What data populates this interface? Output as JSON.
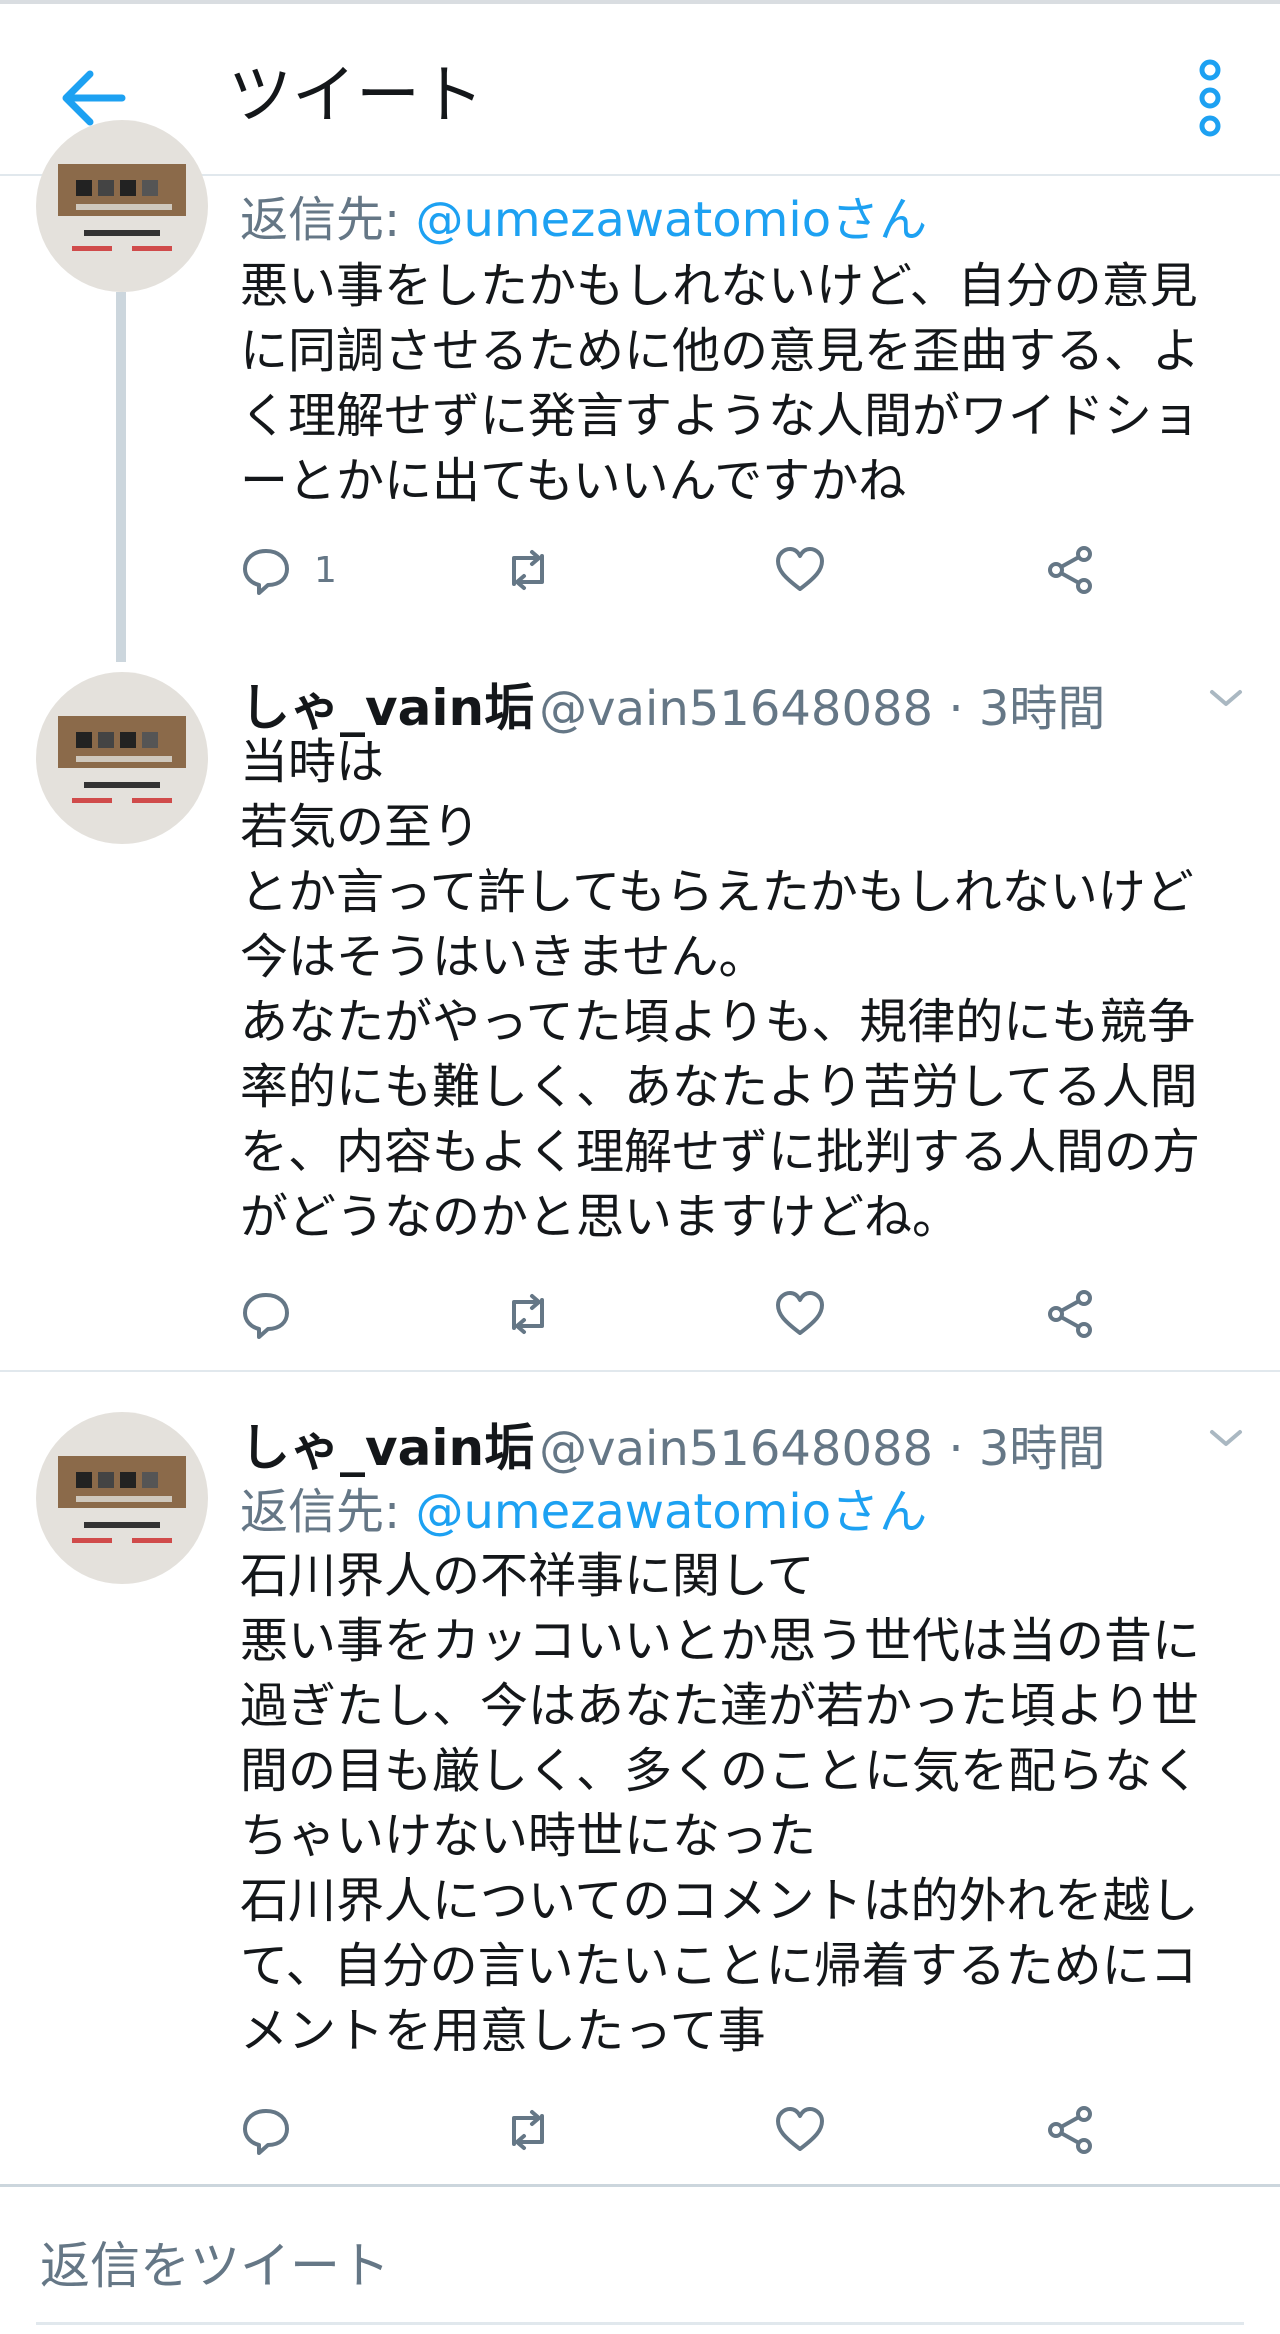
{
  "header": {
    "title": "ツイート",
    "back_icon": "arrow-left-icon",
    "more_icon": "more-vertical-icon",
    "accent_color": "#1da1f2"
  },
  "tweets": [
    {
      "reply_prefix": "返信先: ",
      "reply_mention": "@umezawatomioさん",
      "text": "悪い事をしたかもしれないけど、自分の意見\nに同調させるために他の意見を歪曲する、よ\nく理解せずに発言すような人間がワイドショ\nーとかに出てもいいんですかね",
      "reply_count": "1"
    },
    {
      "name": "しゃ_vain垢",
      "handle": "@vain51648088 · 3時間",
      "text": "当時は\n若気の至り\nとか言って許してもらえたかもしれないけど\n今はそうはいきません。\nあなたがやってた頃よりも、規律的にも競争\n率的にも難しく、あなたより苦労してる人間\nを、内容もよく理解せずに批判する人間の方\nがどうなのかと思いますけどね。"
    },
    {
      "name": "しゃ_vain垢",
      "handle": "@vain51648088 · 3時間",
      "reply_prefix": "返信先: ",
      "reply_mention": "@umezawatomioさん",
      "text": "石川界人の不祥事に関して\n悪い事をカッコいいとか思う世代は当の昔に\n過ぎたし、今はあなた達が若かった頃より世\n間の目も厳しく、多くのことに気を配らなく\nちゃいけない時世になった\n石川界人についてのコメントは的外れを越し\nて、自分の言いたいことに帰着するためにコ\nメントを用意したって事"
    }
  ],
  "reply_placeholder": "返信をツイート"
}
